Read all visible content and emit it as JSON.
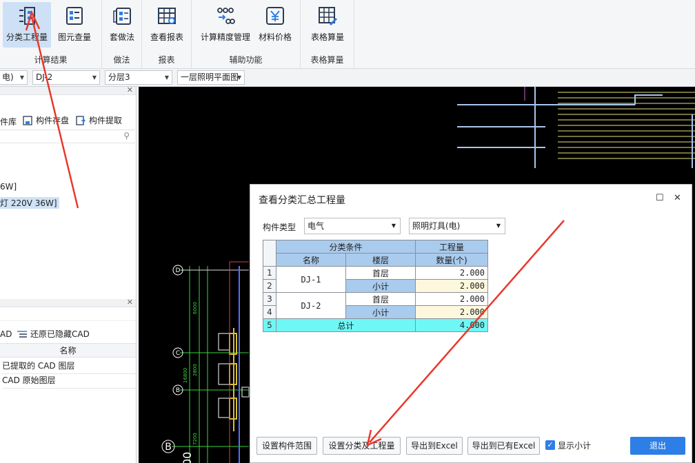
{
  "ribbon": {
    "groups": [
      {
        "label": "计算结果",
        "buttons": [
          {
            "label": "分类工程量",
            "icon": "list-icon",
            "active": true
          },
          {
            "label": "图元查量",
            "icon": "component-query-icon"
          }
        ]
      },
      {
        "label": "做法",
        "buttons": [
          {
            "label": "套做法",
            "icon": "apply-method-icon"
          }
        ]
      },
      {
        "label": "报表",
        "buttons": [
          {
            "label": "查看报表",
            "icon": "report-table-icon"
          }
        ]
      },
      {
        "label": "辅助功能",
        "buttons": [
          {
            "label": "计算精度管理",
            "icon": "precision-icon"
          },
          {
            "label": "材料价格",
            "icon": "yen-icon"
          }
        ]
      },
      {
        "label": "表格算量",
        "buttons": [
          {
            "label": "表格算量",
            "icon": "table-edit-icon"
          }
        ]
      }
    ]
  },
  "toolbar": {
    "selects": [
      "电)",
      "DJ-2",
      "分层3",
      "一层照明平面图"
    ]
  },
  "left_panel": {
    "panel1": {
      "actions": [
        "件库",
        "构件存盘",
        "构件提取"
      ],
      "items": [
        "6W]",
        "灯 220V 36W]"
      ]
    },
    "panel2": {
      "actions": [
        "AD",
        "还原已隐藏CAD"
      ],
      "column_header": "名称",
      "rows": [
        "已提取的 CAD 图层",
        "CAD 原始图层"
      ]
    }
  },
  "canvas": {
    "axis_labels": [
      "D",
      "C",
      "B",
      "B"
    ],
    "dims": [
      "6000",
      "2800",
      "16800",
      "7200"
    ]
  },
  "dialog": {
    "title": "查看分类汇总工程量",
    "type_label": "构件类型",
    "type_value": "电气",
    "subtype_value": "照明灯具(电)",
    "table": {
      "header_group": "分类条件",
      "header_qty": "工程量",
      "col_name": "名称",
      "col_floor": "楼层",
      "col_count": "数量(个)",
      "rows": [
        {
          "no": "1",
          "name": "DJ-1",
          "floor": "首层",
          "value": "2.000"
        },
        {
          "no": "2",
          "floor": "小计",
          "value": "2.000"
        },
        {
          "no": "3",
          "name": "DJ-2",
          "floor": "首层",
          "value": "2.000"
        },
        {
          "no": "4",
          "floor": "小计",
          "value": "2.000"
        },
        {
          "no": "5",
          "floor": "总计",
          "value": "4.000"
        }
      ]
    },
    "buttons": {
      "set_range": "设置构件范围",
      "set_class": "设置分类及工程量",
      "export_excel": "导出到Excel",
      "export_existing": "导出到已有Excel",
      "show_subtotal": "显示小计",
      "exit": "退出"
    },
    "show_subtotal_checked": true
  },
  "colors": {
    "header_blue": "#a9cbee",
    "subtotal_yellow": "#fdf8dd",
    "total_cyan": "#6ff7f5",
    "accent": "#2d7ee6",
    "arrow_red": "#e8382b"
  }
}
